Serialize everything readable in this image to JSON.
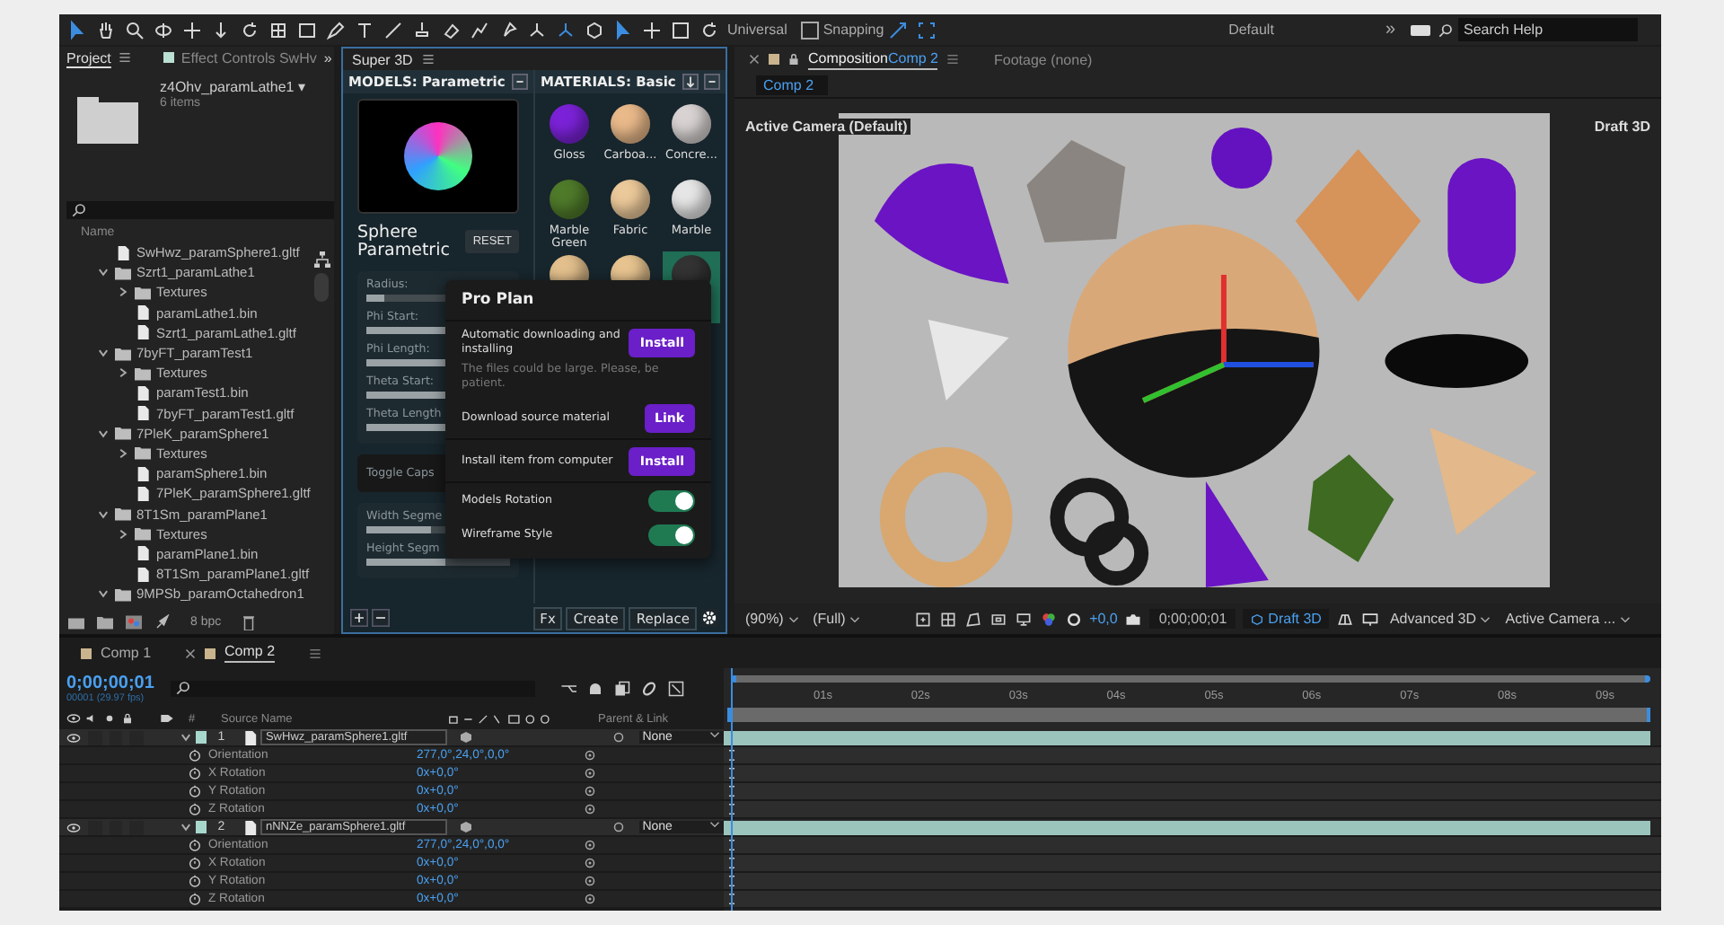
{
  "toolbar": {
    "universal": "Universal",
    "snapping": {
      "label": "Snapping",
      "checked": false
    },
    "workspace": "Default",
    "more": "»",
    "search": {
      "placeholder": "Search Help"
    }
  },
  "project": {
    "tabs": [
      {
        "label": "Project",
        "selected": true
      },
      {
        "label": "Effect Controls SwHv",
        "selected": false
      }
    ],
    "more": "»",
    "item_name": "z4Ohv_paramLathe1 ▾",
    "item_count": "6 items",
    "column": "Name",
    "bit_depth": "8 bpc",
    "tree": [
      {
        "kind": "file",
        "name": "SwHwz_paramSphere1.gltf"
      },
      {
        "kind": "folder",
        "name": "Szrt1_paramLathe1",
        "expanded": true,
        "children": [
          {
            "kind": "folder",
            "name": "Textures",
            "expanded": false
          },
          {
            "kind": "file",
            "name": "paramLathe1.bin"
          },
          {
            "kind": "file",
            "name": "Szrt1_paramLathe1.gltf"
          }
        ]
      },
      {
        "kind": "folder",
        "name": "7byFT_paramTest1",
        "expanded": true,
        "children": [
          {
            "kind": "folder",
            "name": "Textures",
            "expanded": false
          },
          {
            "kind": "file",
            "name": "paramTest1.bin"
          },
          {
            "kind": "file",
            "name": "7byFT_paramTest1.gltf"
          }
        ]
      },
      {
        "kind": "folder",
        "name": "7PleK_paramSphere1",
        "expanded": true,
        "children": [
          {
            "kind": "folder",
            "name": "Textures",
            "expanded": false
          },
          {
            "kind": "file",
            "name": "paramSphere1.bin"
          },
          {
            "kind": "file",
            "name": "7PleK_paramSphere1.gltf"
          }
        ]
      },
      {
        "kind": "folder",
        "name": "8T1Sm_paramPlane1",
        "expanded": true,
        "children": [
          {
            "kind": "folder",
            "name": "Textures",
            "expanded": false
          },
          {
            "kind": "file",
            "name": "paramPlane1.bin"
          },
          {
            "kind": "file",
            "name": "8T1Sm_paramPlane1.gltf"
          }
        ]
      },
      {
        "kind": "folder",
        "name": "9MPSb_paramOctahedron1",
        "expanded": true
      }
    ]
  },
  "super3d": {
    "title": "Super 3D",
    "models_header": "MODELS: Parametric",
    "materials_header": "MATERIALS: Basic",
    "model_name": "Sphere Parametric",
    "reset": "RESET",
    "params": [
      {
        "label": "Radius:",
        "level": 0.12
      },
      {
        "label": "Phi Start:",
        "level": 0.55
      },
      {
        "label": "Phi Length:",
        "level": 0.55
      },
      {
        "label": "Theta Start:",
        "level": 0.55
      },
      {
        "label": "Theta Length",
        "level": 0.55
      }
    ],
    "toggle_caps": "Toggle Caps",
    "segments": [
      {
        "label": "Width Segme",
        "level": 0.45
      },
      {
        "label": "Height Segm",
        "level": 0.55
      }
    ],
    "materials": [
      {
        "label": "Gloss",
        "color": "#7b22d8",
        "selected": false
      },
      {
        "label": "Carboa...",
        "color": "#e9b98a",
        "selected": false
      },
      {
        "label": "Concre...",
        "color": "#d8d2d2",
        "selected": false
      },
      {
        "label": "Marble Green",
        "color": "#4f7a2a",
        "selected": false
      },
      {
        "label": "Fabric",
        "color": "#ecc99a",
        "selected": false
      },
      {
        "label": "Marble",
        "color": "#e6e6e6",
        "selected": false
      },
      {
        "color": "#e2bf8c",
        "selected": false
      },
      {
        "color": "#e6c38f",
        "selected": false
      },
      {
        "color": "#333333",
        "selected": true
      }
    ],
    "buttons": [
      {
        "label": "Fx"
      },
      {
        "label": "Create"
      },
      {
        "label": "Replace"
      }
    ]
  },
  "pro_plan": {
    "title": "Pro Plan",
    "rows": [
      {
        "kind": "action",
        "label": "Automatic downloading and installing",
        "button": "Install",
        "note": "The files could be large. Please, be patient."
      },
      {
        "kind": "action",
        "label": "Download source material",
        "button": "Link"
      },
      {
        "kind": "action",
        "label": "Install item from computer",
        "button": "Install"
      },
      {
        "kind": "toggle",
        "label": "Models Rotation",
        "on": true
      },
      {
        "kind": "toggle",
        "label": "Wireframe Style",
        "on": true
      }
    ]
  },
  "composition": {
    "tabs": [
      {
        "label": "Composition",
        "comp": "Comp 2",
        "selected": true
      },
      {
        "label": "Footage (none)",
        "selected": false
      }
    ],
    "breadcrumb": "Comp 2",
    "camera_label": "Active Camera (Default)",
    "renderer_label": "Draft 3D",
    "viewer_bar": {
      "zoom": "(90%)",
      "resolution": "(Full)",
      "exposure": "+0,0",
      "timecode": "0;00;00;01",
      "draft": "Draft 3D",
      "renderer": "Advanced 3D",
      "view": "Active Camera ..."
    }
  },
  "timeline": {
    "tabs": [
      {
        "label": "Comp 1",
        "selected": false
      },
      {
        "label": "Comp 2",
        "selected": true
      }
    ],
    "timecode": "0;00;00;01",
    "fps": "00001 (29.97 fps)",
    "number_header": "#",
    "name_header": "Source Name",
    "parent_header": "Parent & Link",
    "ruler": [
      "01s",
      "02s",
      "03s",
      "04s",
      "05s",
      "06s",
      "07s",
      "08s",
      "09s"
    ],
    "layers": [
      {
        "number": "1",
        "name": "SwHwz_paramSphere1.gltf",
        "parent": "None",
        "expanded": true,
        "properties": [
          {
            "name": "Orientation",
            "value": "277,0°,24,0°,0,0°"
          },
          {
            "name": "X Rotation",
            "value": "0x+0,0°"
          },
          {
            "name": "Y Rotation",
            "value": "0x+0,0°"
          },
          {
            "name": "Z Rotation",
            "value": "0x+0,0°"
          }
        ]
      },
      {
        "number": "2",
        "name": "nNNZe_paramSphere1.gltf",
        "parent": "None",
        "expanded": true,
        "properties": [
          {
            "name": "Orientation",
            "value": "277,0°,24,0°,0,0°"
          },
          {
            "name": "X Rotation",
            "value": "0x+0,0°"
          },
          {
            "name": "Y Rotation",
            "value": "0x+0,0°"
          },
          {
            "name": "Z Rotation",
            "value": "0x+0,0°"
          }
        ]
      }
    ]
  }
}
